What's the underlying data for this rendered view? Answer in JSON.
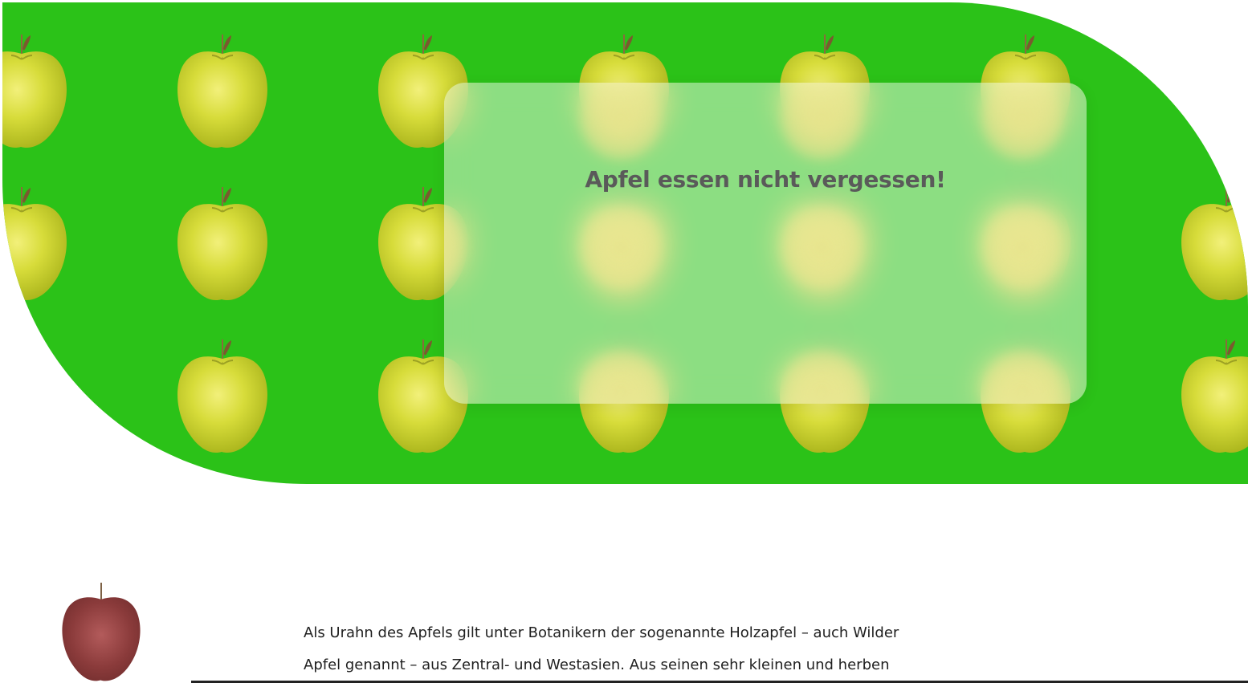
{
  "hero": {
    "bg_color": "#2bc218",
    "card_title": "Apfel essen nicht vergessen!"
  },
  "article": {
    "line1": "Als Urahn des Apfels gilt unter Botanikern der sogenannte Holzapfel – auch Wilder",
    "line2": "Apfel genannt – aus Zentral- und Westasien. Aus seinen sehr kleinen und herben"
  },
  "icons": {
    "apple_green": "green-apple-icon",
    "apple_red": "red-apple-icon"
  }
}
